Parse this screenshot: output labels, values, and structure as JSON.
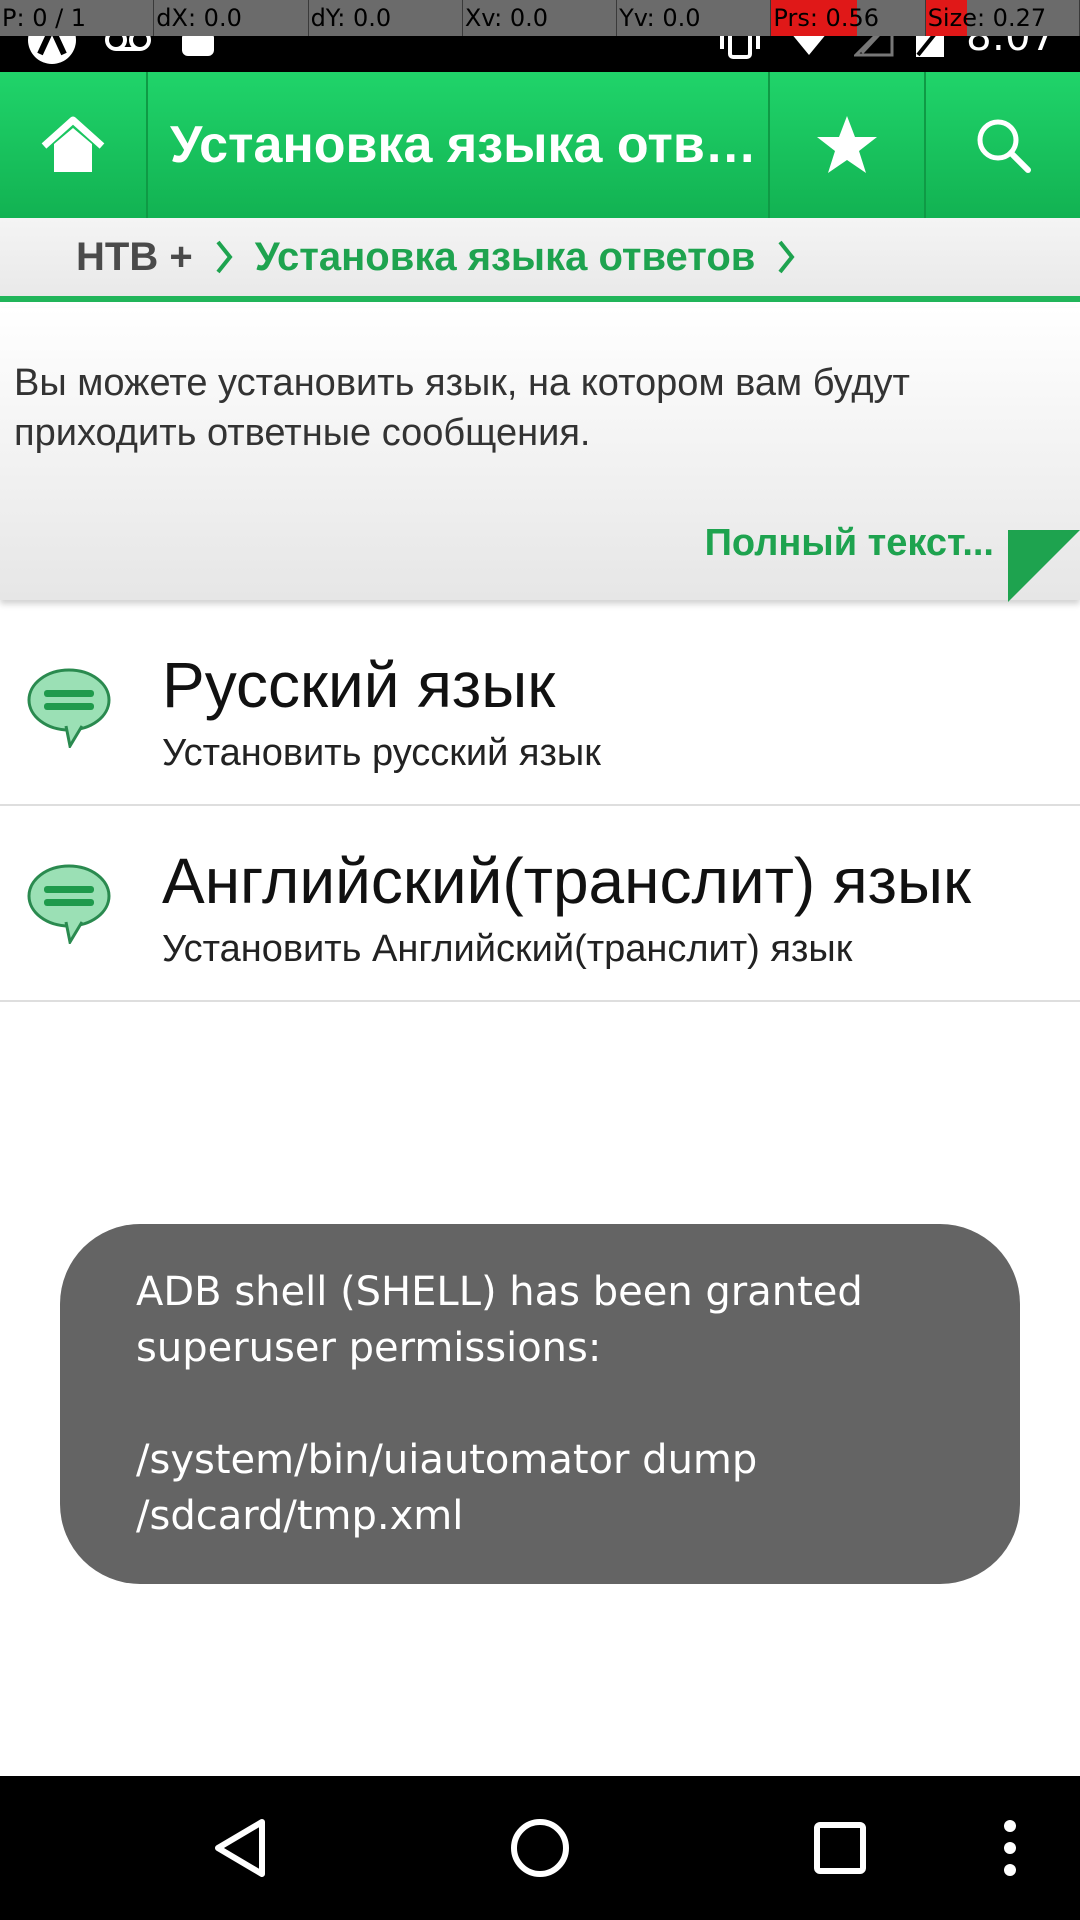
{
  "status_bar": {
    "pointer_location": [
      {
        "label": "P: 0 / 1"
      },
      {
        "label": "dX: 0.0"
      },
      {
        "label": "dY: 0.0"
      },
      {
        "label": "Xv: 0.0"
      },
      {
        "label": "Yv: 0.0"
      },
      {
        "label": "Prs: 0.56",
        "fill": 0.56
      },
      {
        "label": "Size: 0.27",
        "fill": 0.27
      }
    ],
    "time": "8:07",
    "icons": [
      "android-icon",
      "voicemail-icon",
      "android-head-icon",
      "vibrate-icon",
      "wifi-icon",
      "signal-icon",
      "battery-charging-icon"
    ]
  },
  "action_bar": {
    "title": "Установка языка отв…",
    "home_icon": "home-icon",
    "favorite_icon": "star-icon",
    "search_icon": "search-icon"
  },
  "breadcrumb": {
    "items": [
      "НТВ +",
      "Установка языка ответов"
    ]
  },
  "description": {
    "text": "Вы можете установить язык, на котором вам будут приходить ответные сообщения.",
    "full_text_link": "Полный текст..."
  },
  "list": {
    "items": [
      {
        "title": "Русский язык",
        "subtitle": "Установить русский язык",
        "icon": "chat-bubble-icon"
      },
      {
        "title": "Английский(транслит) язык",
        "subtitle": "Установить Английский(транслит) язык",
        "icon": "chat-bubble-icon"
      }
    ]
  },
  "toast": {
    "line1": "ADB shell (SHELL) has been granted superuser permissions:",
    "line2": "/system/bin/uiautomator dump /sdcard/tmp.xml"
  },
  "colors": {
    "accent_green": "#1ea34f",
    "action_bar_green": "#18c25c",
    "toast_gray": "#646464"
  }
}
